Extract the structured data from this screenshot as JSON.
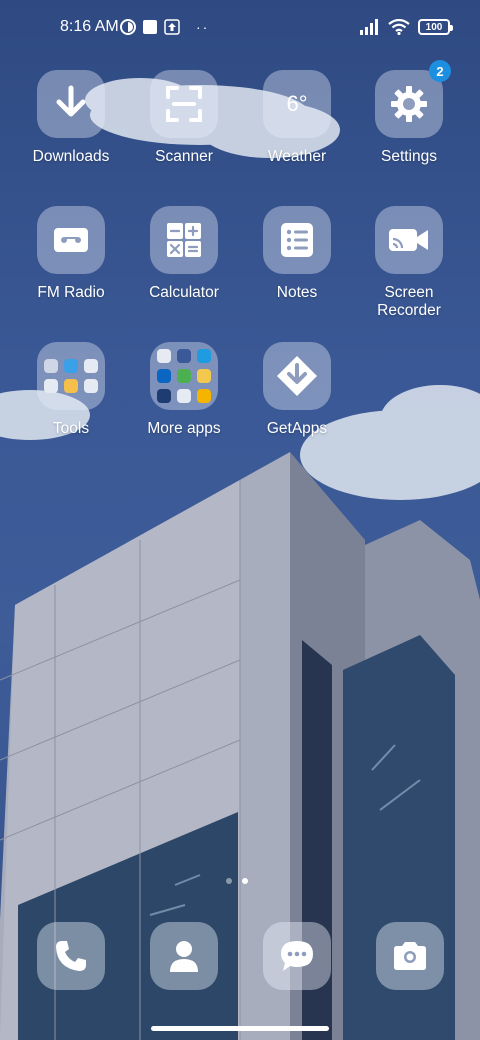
{
  "status_bar": {
    "time": "8:16 AM",
    "battery": "100",
    "more_indicator": "··"
  },
  "apps": [
    {
      "label": "Downloads",
      "icon": "download-arrow-icon"
    },
    {
      "label": "Scanner",
      "icon": "scan-frame-icon"
    },
    {
      "label": "Weather",
      "icon": "weather-temperature",
      "text": "6°"
    },
    {
      "label": "Settings",
      "icon": "gear-icon",
      "badge": "2"
    },
    {
      "label": "FM Radio",
      "icon": "radio-cassette-icon"
    },
    {
      "label": "Calculator",
      "icon": "calculator-icon"
    },
    {
      "label": "Notes",
      "icon": "list-icon"
    },
    {
      "label": "Screen Recorder",
      "icon": "video-camera-icon"
    },
    {
      "label": "Tools",
      "icon": "folder-icon"
    },
    {
      "label": "More apps",
      "icon": "folder-icon"
    },
    {
      "label": "GetApps",
      "icon": "getapps-diamond-icon"
    }
  ],
  "dock": [
    {
      "icon": "phone-icon"
    },
    {
      "icon": "contacts-person-icon"
    },
    {
      "icon": "messages-bubble-icon"
    },
    {
      "icon": "camera-icon"
    }
  ],
  "pages": {
    "count": 2,
    "active": 2
  },
  "colors": {
    "badge": "#1d8fe0",
    "sky": "#3a5895"
  }
}
